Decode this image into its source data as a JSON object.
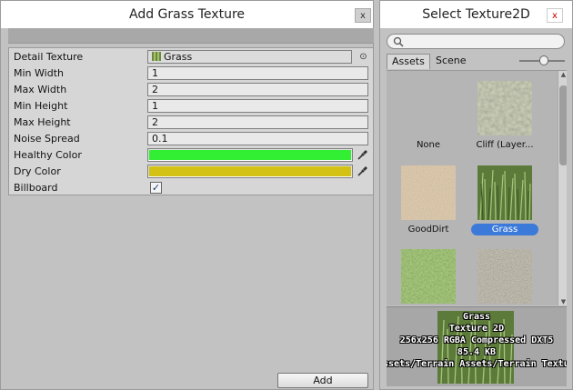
{
  "left_window": {
    "title": "Add Grass Texture",
    "close_label": "x",
    "properties": [
      {
        "label": "Detail Texture",
        "value": "Grass",
        "kind": "object"
      },
      {
        "label": "Min Width",
        "value": "1",
        "kind": "text"
      },
      {
        "label": "Max Width",
        "value": "2",
        "kind": "text"
      },
      {
        "label": "Min Height",
        "value": "1",
        "kind": "text"
      },
      {
        "label": "Max Height",
        "value": "2",
        "kind": "text"
      },
      {
        "label": "Noise Spread",
        "value": "0.1",
        "kind": "text"
      },
      {
        "label": "Healthy Color",
        "color": "#33ef33",
        "kind": "color"
      },
      {
        "label": "Dry Color",
        "color": "#d3c113",
        "kind": "color"
      },
      {
        "label": "Billboard",
        "checked": true,
        "kind": "checkbox"
      }
    ],
    "object_picker_glyph": "⊙",
    "check_glyph": "✓",
    "add_button": "Add"
  },
  "right_window": {
    "title": "Select Texture2D",
    "close_label": "x",
    "search": {
      "value": "",
      "placeholder": ""
    },
    "tabs": [
      {
        "label": "Assets",
        "active": true
      },
      {
        "label": "Scene",
        "active": false
      }
    ],
    "items": [
      {
        "label": "None",
        "texture": "none",
        "selected": false
      },
      {
        "label": "Cliff (Layer...",
        "texture": "cliff",
        "selected": false
      },
      {
        "label": "GoodDirt",
        "texture": "dirt",
        "selected": false
      },
      {
        "label": "Grass",
        "texture": "grass",
        "selected": true
      },
      {
        "label": "",
        "texture": "moss",
        "selected": false
      },
      {
        "label": "",
        "texture": "pebbles",
        "selected": false
      }
    ],
    "preview": {
      "name": "Grass",
      "type": "Texture 2D",
      "format": "256x256  RGBA Compressed DXT5",
      "size": "85.4 KB",
      "path": "Assets/Terrain Assets/Terrain Textures"
    }
  },
  "colors": {
    "selection": "#3b7ad9",
    "healthy": "#33ef33",
    "dry": "#d3c113"
  }
}
